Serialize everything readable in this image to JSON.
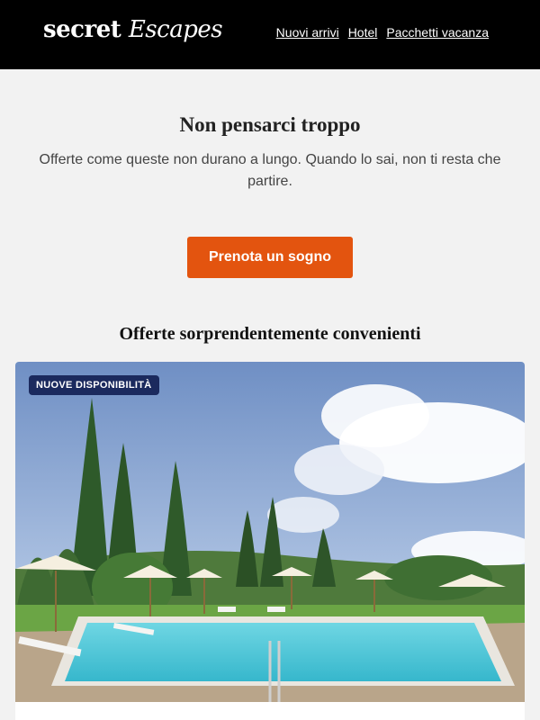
{
  "header": {
    "logo_text_1": "secret",
    "logo_text_2": "Escapes",
    "nav": [
      "Nuovi arrivi",
      "Hotel",
      "Pacchetti vacanza"
    ]
  },
  "hero": {
    "title": "Non pensarci troppo",
    "subtitle": "Offerte come queste non durano a lungo. Quando lo sai, non ti resta che partire.",
    "cta_label": "Prenota un sogno"
  },
  "section": {
    "title": "Offerte sorprendentemente convenienti"
  },
  "card": {
    "badge": "NUOVE DISPONIBILITÀ",
    "image_icon": "hotel-pool-photo"
  },
  "colors": {
    "header_bg": "#000000",
    "cta": "#e3540f",
    "badge_bg": "#1b2a5e",
    "page_bg": "#f2f2f2"
  }
}
